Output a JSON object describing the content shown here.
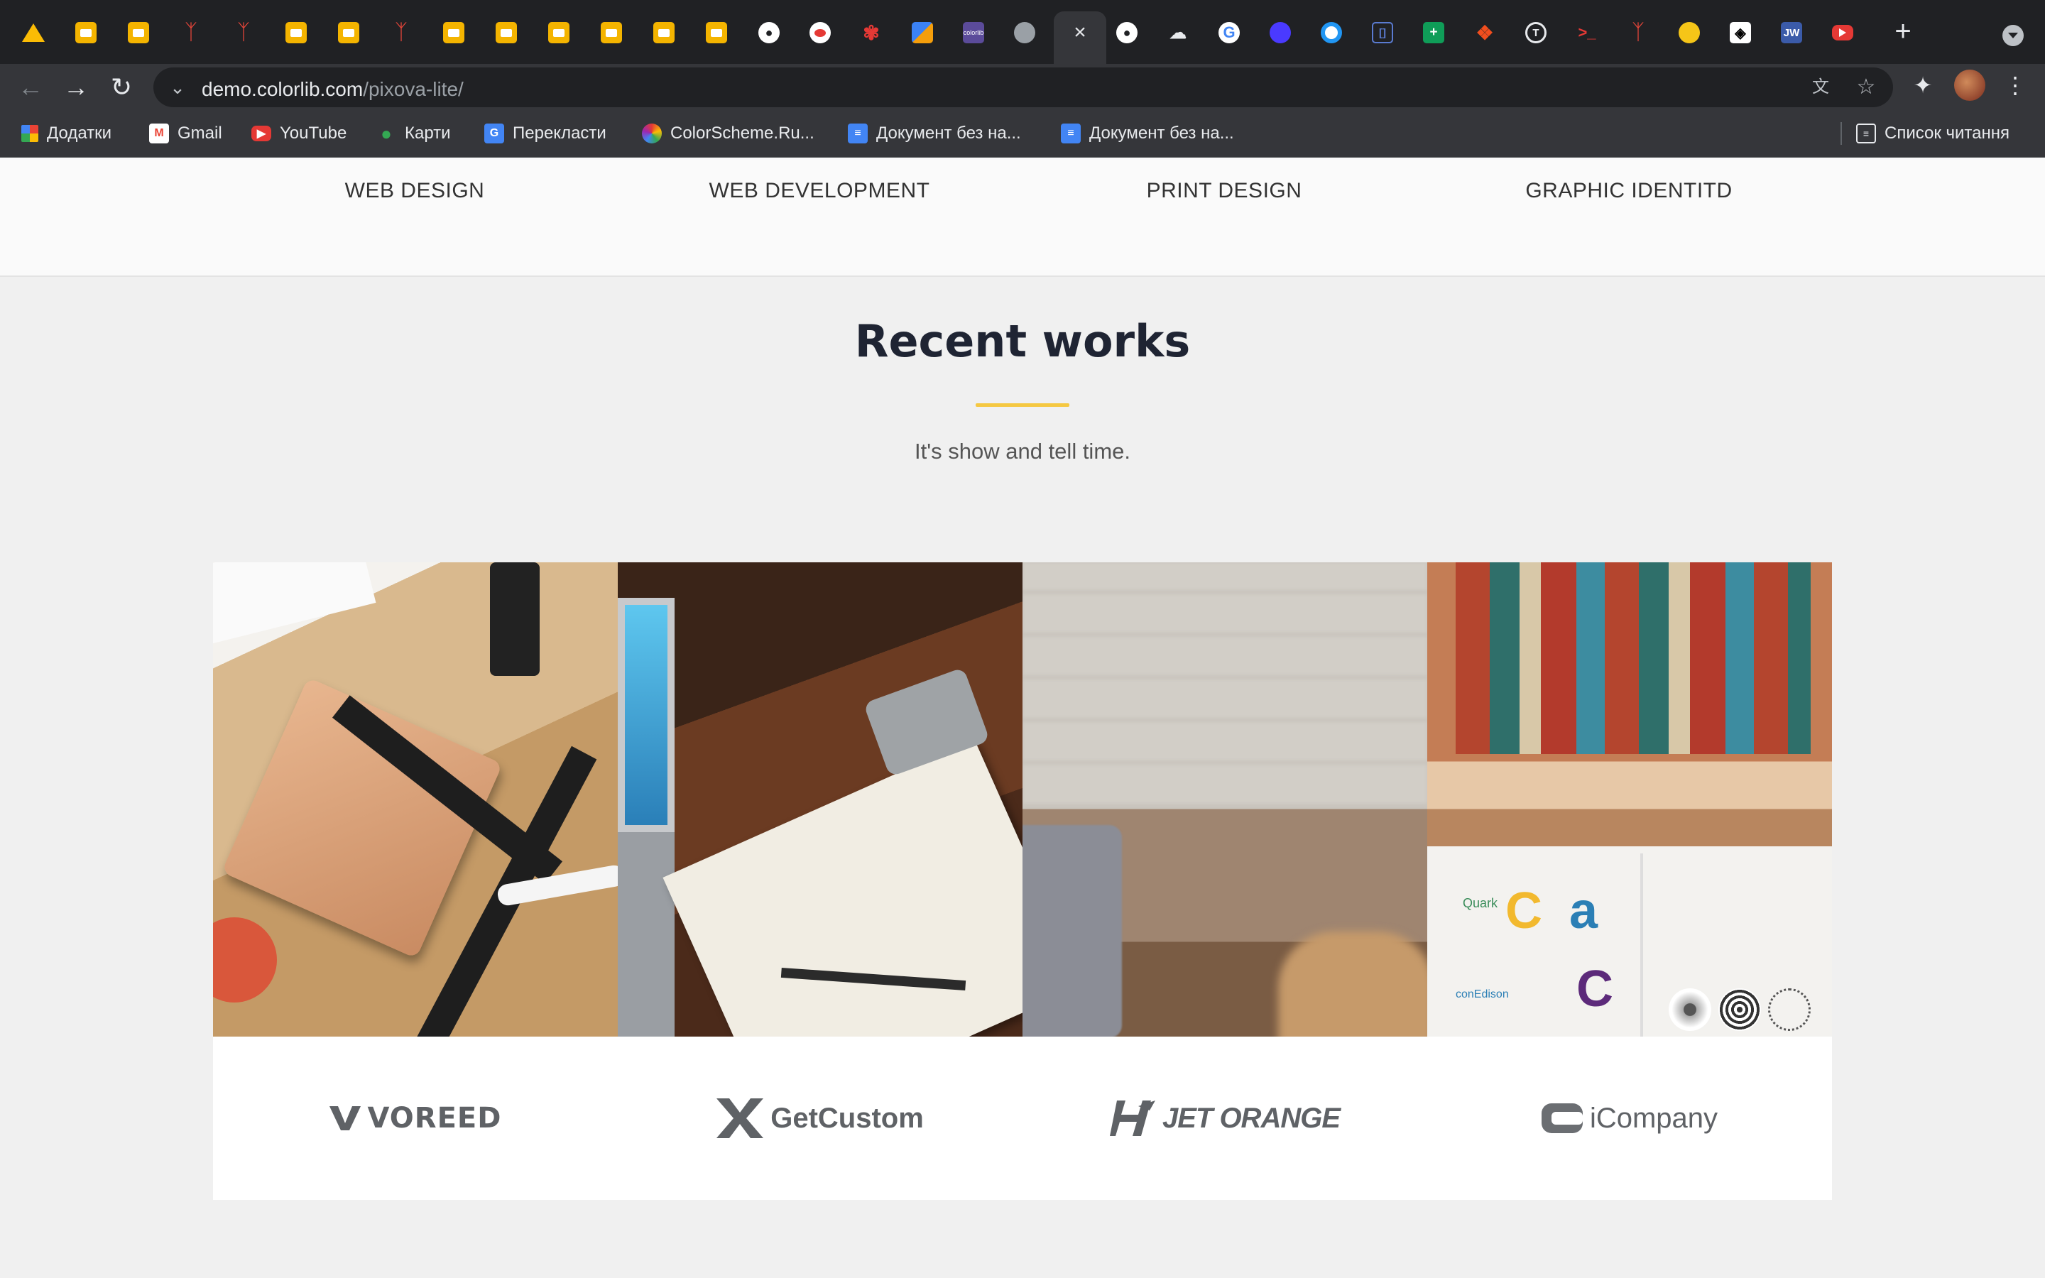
{
  "browser": {
    "tabs": [
      {
        "icon": "google-drive-icon"
      },
      {
        "icon": "slides-icon"
      },
      {
        "icon": "slides-icon"
      },
      {
        "icon": "x-icon"
      },
      {
        "icon": "x-icon"
      },
      {
        "icon": "slides-icon"
      },
      {
        "icon": "slides-icon"
      },
      {
        "icon": "x-icon"
      },
      {
        "icon": "slides-icon"
      },
      {
        "icon": "slides-icon"
      },
      {
        "icon": "slides-icon"
      },
      {
        "icon": "slides-icon"
      },
      {
        "icon": "slides-icon"
      },
      {
        "icon": "slides-icon"
      },
      {
        "icon": "github-icon"
      },
      {
        "icon": "red-dot-icon"
      },
      {
        "icon": "flower-icon"
      },
      {
        "icon": "colorful-icon"
      },
      {
        "icon": "colorlib-icon"
      },
      {
        "icon": "globe-icon"
      },
      {
        "icon": "close-icon",
        "active": true
      },
      {
        "icon": "github-icon"
      },
      {
        "icon": "cloud-icon"
      },
      {
        "icon": "google-icon"
      },
      {
        "icon": "purple-circle-icon"
      },
      {
        "icon": "target-icon"
      },
      {
        "icon": "code-icon"
      },
      {
        "icon": "sheets-icon"
      },
      {
        "icon": "figma-icon"
      },
      {
        "icon": "t-icon"
      },
      {
        "icon": "terminal-icon"
      },
      {
        "icon": "x-icon"
      },
      {
        "icon": "coin-icon"
      },
      {
        "icon": "codepen-icon"
      },
      {
        "icon": "jw-icon"
      },
      {
        "icon": "youtube-icon"
      }
    ],
    "colorlib_favicon_text": "colorlib",
    "jw_text": "JW",
    "address": {
      "domain": "demo.colorlib.com",
      "path": "/pixova-lite/"
    },
    "bookmarks": [
      {
        "label": "Додатки",
        "icon": "apps-icon"
      },
      {
        "label": "Gmail",
        "icon": "gmail-icon"
      },
      {
        "label": "YouTube",
        "icon": "youtube-icon"
      },
      {
        "label": "Карти",
        "icon": "maps-icon"
      },
      {
        "label": "Перекласти",
        "icon": "translate-icon"
      },
      {
        "label": "ColorScheme.Ru...",
        "icon": "colorscheme-icon"
      },
      {
        "label": "Документ без на...",
        "icon": "docs-icon"
      },
      {
        "label": "Документ без на...",
        "icon": "docs-icon"
      }
    ],
    "reading_list": "Список читання"
  },
  "page": {
    "services": [
      "WEB DESIGN",
      "WEB DEVELOPMENT",
      "PRINT DESIGN",
      "GRAPHIC IDENTITD"
    ],
    "recent_works": {
      "title": "Recent works",
      "subtitle": "It's show and tell time.",
      "accent_color": "#f5c842"
    },
    "works": [
      {
        "name": "work-notebook-desk"
      },
      {
        "name": "work-laptop-sketchbook"
      },
      {
        "name": "work-blurred-cafe"
      },
      {
        "name": "work-books-shelf",
        "logos": [
          "Quark",
          "conEdison"
        ]
      }
    ],
    "clients": [
      {
        "name": "VOREED",
        "logo": "voreed-logo"
      },
      {
        "name": "GetCustom",
        "logo": "getcustom-logo"
      },
      {
        "name": "JET ORANGE",
        "logo": "jet-orange-logo"
      },
      {
        "name": "iCompany",
        "logo": "icompany-logo"
      }
    ]
  }
}
